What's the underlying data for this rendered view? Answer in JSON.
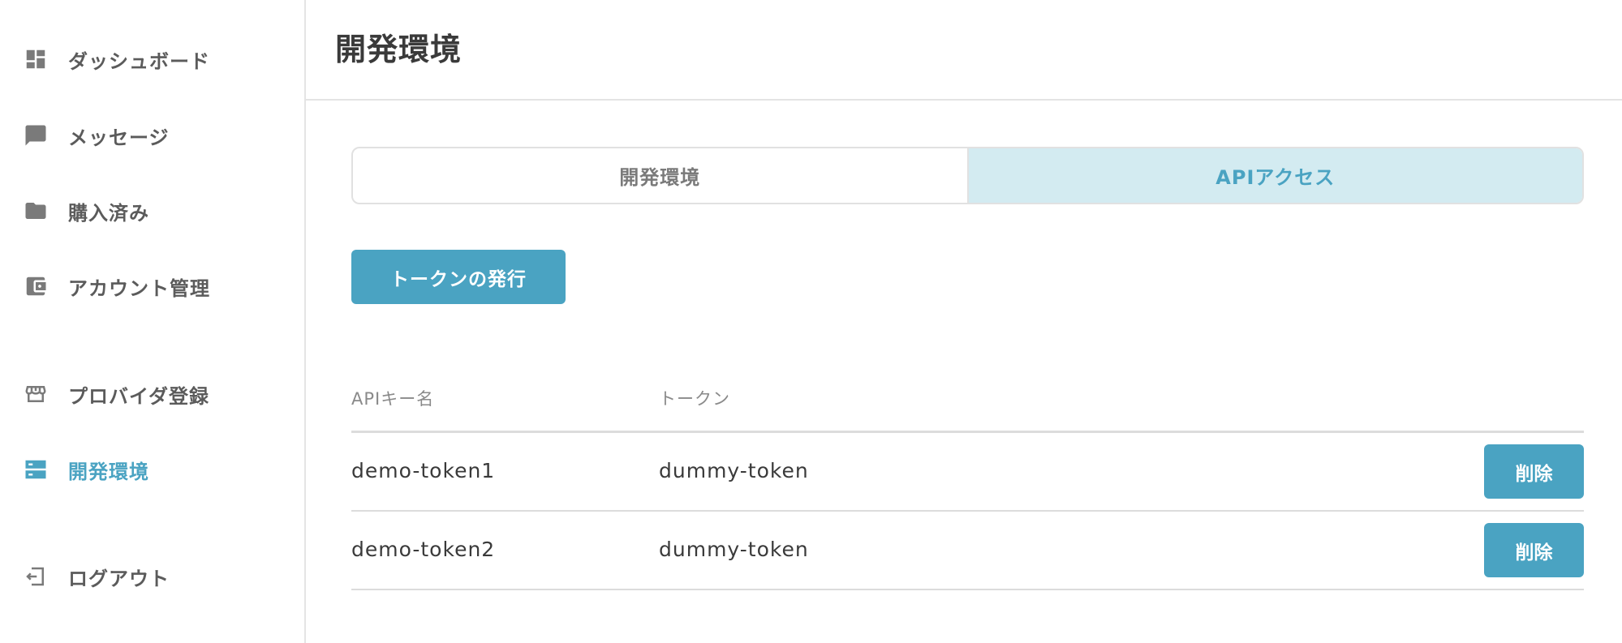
{
  "sidebar": {
    "items": [
      {
        "label": "ダッシュボード",
        "icon": "dashboard-icon"
      },
      {
        "label": "メッセージ",
        "icon": "message-icon"
      },
      {
        "label": "購入済み",
        "icon": "folder-icon"
      },
      {
        "label": "アカウント管理",
        "icon": "wallet-icon"
      },
      {
        "label": "プロバイダ登録",
        "icon": "store-icon"
      },
      {
        "label": "開発環境",
        "icon": "server-icon",
        "active": true
      },
      {
        "label": "ログアウト",
        "icon": "logout-icon"
      }
    ]
  },
  "header": {
    "title": "開発環境"
  },
  "tabs": [
    {
      "label": "開発環境"
    },
    {
      "label": "APIアクセス",
      "active": true
    }
  ],
  "actions": {
    "issue_token_label": "トークンの発行"
  },
  "table": {
    "headers": {
      "name": "APIキー名",
      "token": "トークン"
    },
    "rows": [
      {
        "name": "demo-token1",
        "token": "dummy-token",
        "delete_label": "削除"
      },
      {
        "name": "demo-token2",
        "token": "dummy-token",
        "delete_label": "削除"
      }
    ]
  },
  "colors": {
    "accent": "#4aa3c2",
    "accent_light": "#d3ebf1",
    "icon_gray": "#7a7a7a",
    "text": "#3a3a3a"
  }
}
